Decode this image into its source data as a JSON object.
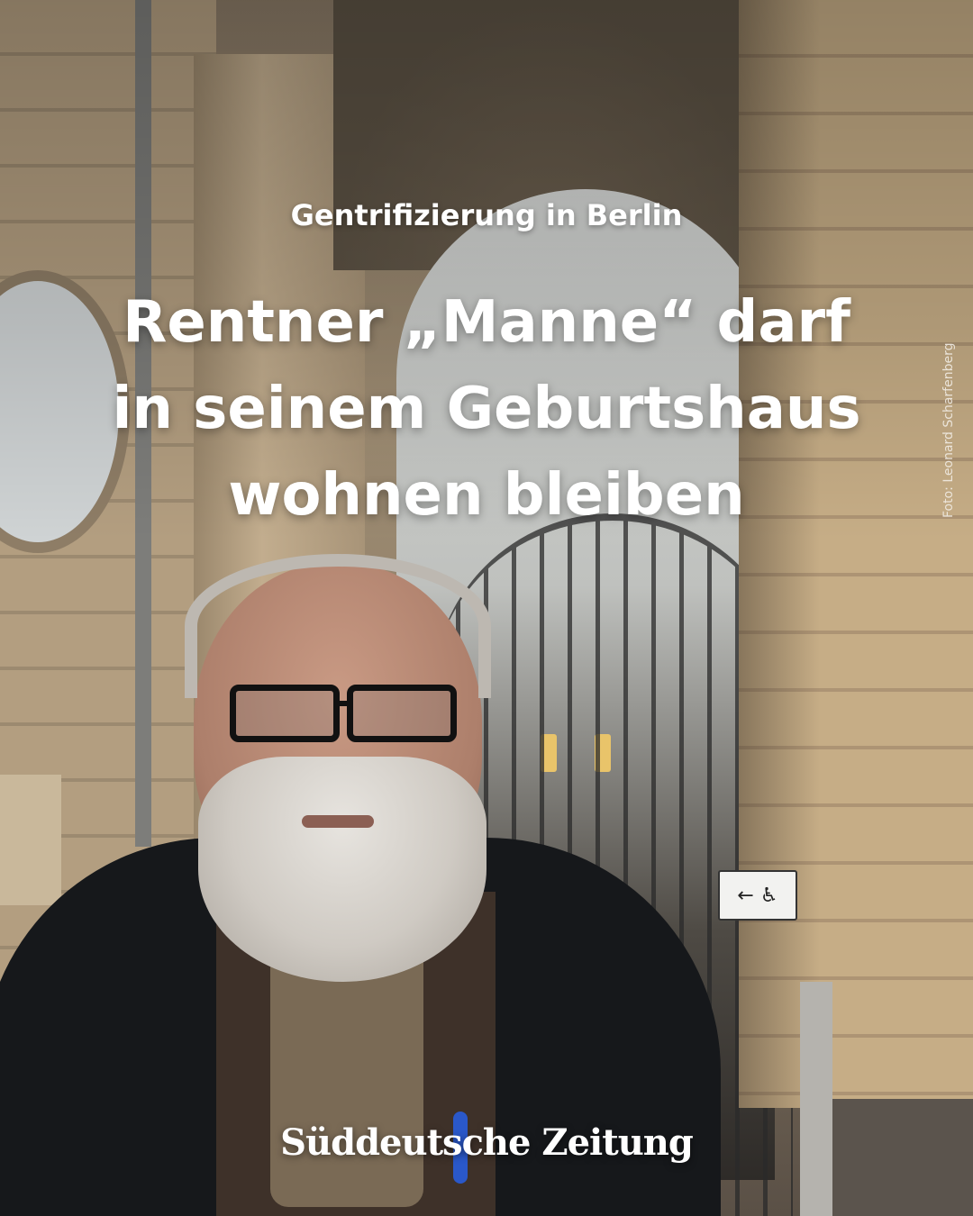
{
  "post": {
    "kicker": "Gentrifizierung in Berlin",
    "headline_lines": [
      "Rentner „Manne“ darf",
      "in seinem Geburtshaus",
      "wohnen bleiben"
    ],
    "photo_credit": "Foto: Leonard Scharfenberg",
    "publisher_logo": "Süddeutsche Zeitung",
    "sign_text": "← ♿"
  },
  "colors": {
    "text": "#ffffff",
    "stone": "#c6ad86",
    "jacket": "#16181b"
  }
}
